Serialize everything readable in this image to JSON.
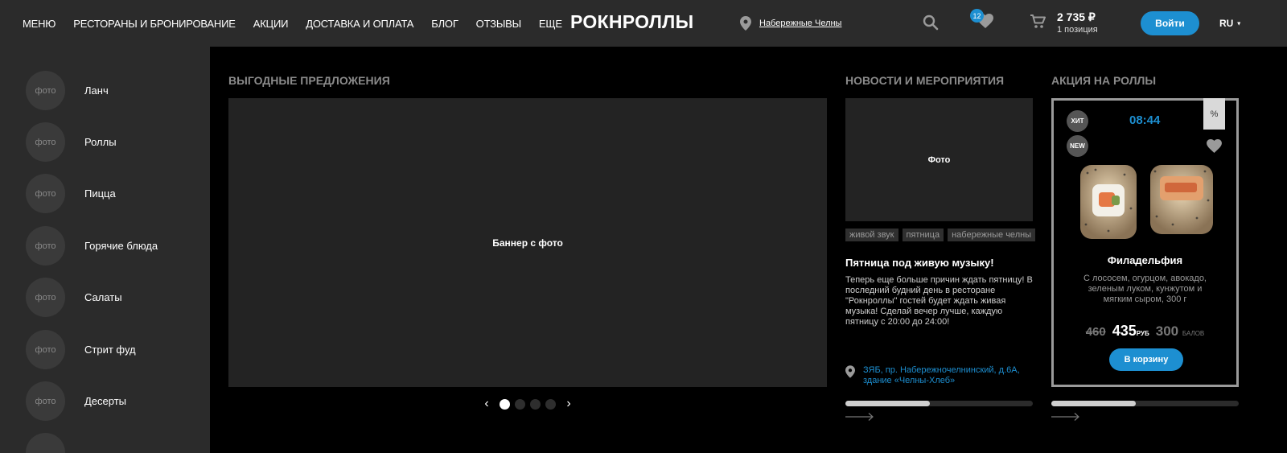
{
  "header": {
    "nav": [
      "МЕНЮ",
      "РЕСТОРАНЫ И БРОНИРОВАНИЕ",
      "АКЦИИ",
      "ДОСТАВКА И ОПЛАТА",
      "БЛОГ",
      "ОТЗЫВЫ",
      "ЕЩЕ"
    ],
    "logo": "РОКНРОЛЛЫ",
    "city": "Набережные Челны",
    "favorites_count": "12",
    "cart_total": "2 735 ₽",
    "cart_items": "1 позиция",
    "login_label": "Войти",
    "language": "RU"
  },
  "sidebar": {
    "photo_placeholder": "фото",
    "categories": [
      "Ланч",
      "Роллы",
      "Пицца",
      "Горячие блюда",
      "Салаты",
      "Стрит фуд",
      "Десерты"
    ]
  },
  "offers": {
    "title": "ВЫГОДНЫЕ ПРЕДЛОЖЕНИЯ",
    "banner_text": "Баннер с фото",
    "slides_count": 4,
    "active_slide": 1
  },
  "news": {
    "title": "НОВОСТИ И МЕРОПРИЯТИЯ",
    "photo_text": "Фото",
    "tags": [
      "живой звук",
      "пятница",
      "набережные челны"
    ],
    "headline": "Пятница под живую музыку!",
    "text": "Теперь еще больше причин ждать пятницу! В последний будний день в ресторане \"Рокнроллы\" гостей будет ждать живая музыка! Сделай вечер лучше, каждую пятницу с 20:00 до 24:00!",
    "address": "ЗЯБ, пр. Набережночелнинский, д.6А, здание «Челны-Хлеб»",
    "progress": 0.45
  },
  "promo": {
    "title": "АКЦИЯ НА РОЛЛЫ",
    "badge_hit": "ХИТ",
    "badge_new": "NEW",
    "timer": "08:44",
    "percent": "%",
    "name": "Филадельфия",
    "description": "С лососем, огурцом, авокадо, зеленым луком, кунжутом и мягким сыром, 300 г",
    "old_price": "460",
    "price": "435",
    "price_unit": "РУБ",
    "points": "300",
    "points_unit": "БАЛОВ",
    "cart_button": "В корзину",
    "progress": 0.45
  },
  "colors": {
    "accent": "#1d8fd1",
    "header_bg": "#2b2b2b",
    "panel_bg": "#232323"
  }
}
